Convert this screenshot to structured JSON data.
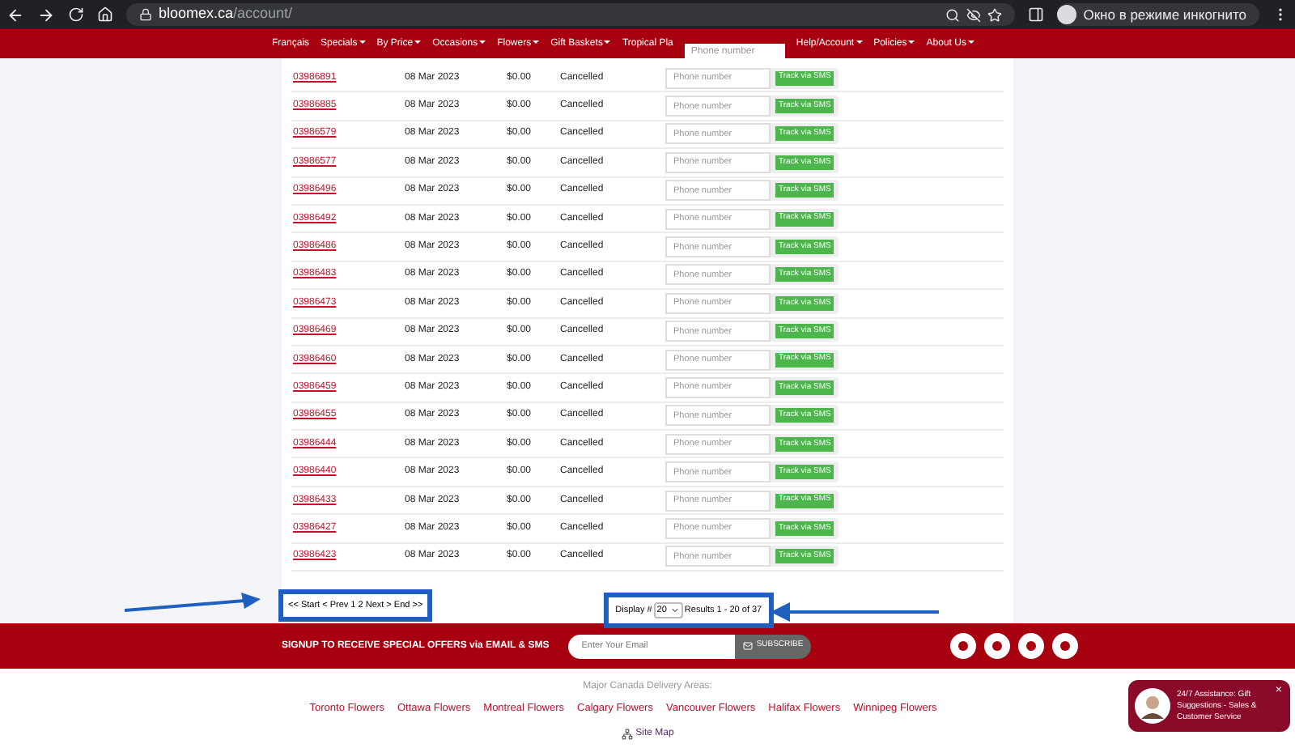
{
  "browser": {
    "url_host": "bloomex.ca",
    "url_path": "/account/",
    "profile": "Окно в режиме инкогнито"
  },
  "nav": [
    {
      "label": "Français",
      "dropdown": false
    },
    {
      "label": "Specials",
      "dropdown": true
    },
    {
      "label": "By Price",
      "dropdown": true
    },
    {
      "label": "Occasions",
      "dropdown": true
    },
    {
      "label": "Flowers",
      "dropdown": true
    },
    {
      "label": "Gift Baskets",
      "dropdown": true
    },
    {
      "label": "Tropical Pla",
      "dropdown": false
    },
    {
      "label": "Help/Account",
      "dropdown": true
    },
    {
      "label": "Policies",
      "dropdown": true
    },
    {
      "label": "About Us",
      "dropdown": true
    }
  ],
  "overlay_field": {
    "placeholder": "Phone number"
  },
  "orders": [
    {
      "number": "03986891",
      "date": "08 Mar 2023",
      "total": "$0.00",
      "status": "Cancelled",
      "placeholder": "Phone number",
      "button": "Track via SMS"
    },
    {
      "number": "03986885",
      "date": "08 Mar 2023",
      "total": "$0.00",
      "status": "Cancelled",
      "placeholder": "Phone number",
      "button": "Track via SMS"
    },
    {
      "number": "03986579",
      "date": "08 Mar 2023",
      "total": "$0.00",
      "status": "Cancelled",
      "placeholder": "Phone number",
      "button": "Track via SMS"
    },
    {
      "number": "03986577",
      "date": "08 Mar 2023",
      "total": "$0.00",
      "status": "Cancelled",
      "placeholder": "Phone number",
      "button": "Track via SMS"
    },
    {
      "number": "03986496",
      "date": "08 Mar 2023",
      "total": "$0.00",
      "status": "Cancelled",
      "placeholder": "Phone number",
      "button": "Track via SMS"
    },
    {
      "number": "03986492",
      "date": "08 Mar 2023",
      "total": "$0.00",
      "status": "Cancelled",
      "placeholder": "Phone number",
      "button": "Track via SMS"
    },
    {
      "number": "03986486",
      "date": "08 Mar 2023",
      "total": "$0.00",
      "status": "Cancelled",
      "placeholder": "Phone number",
      "button": "Track via SMS"
    },
    {
      "number": "03986483",
      "date": "08 Mar 2023",
      "total": "$0.00",
      "status": "Cancelled",
      "placeholder": "Phone number",
      "button": "Track via SMS"
    },
    {
      "number": "03986473",
      "date": "08 Mar 2023",
      "total": "$0.00",
      "status": "Cancelled",
      "placeholder": "Phone number",
      "button": "Track via SMS"
    },
    {
      "number": "03986469",
      "date": "08 Mar 2023",
      "total": "$0.00",
      "status": "Cancelled",
      "placeholder": "Phone number",
      "button": "Track via SMS"
    },
    {
      "number": "03986460",
      "date": "08 Mar 2023",
      "total": "$0.00",
      "status": "Cancelled",
      "placeholder": "Phone number",
      "button": "Track via SMS"
    },
    {
      "number": "03986459",
      "date": "08 Mar 2023",
      "total": "$0.00",
      "status": "Cancelled",
      "placeholder": "Phone number",
      "button": "Track via SMS"
    },
    {
      "number": "03986455",
      "date": "08 Mar 2023",
      "total": "$0.00",
      "status": "Cancelled",
      "placeholder": "Phone number",
      "button": "Track via SMS"
    },
    {
      "number": "03986444",
      "date": "08 Mar 2023",
      "total": "$0.00",
      "status": "Cancelled",
      "placeholder": "Phone number",
      "button": "Track via SMS"
    },
    {
      "number": "03986440",
      "date": "08 Mar 2023",
      "total": "$0.00",
      "status": "Cancelled",
      "placeholder": "Phone number",
      "button": "Track via SMS"
    },
    {
      "number": "03986433",
      "date": "08 Mar 2023",
      "total": "$0.00",
      "status": "Cancelled",
      "placeholder": "Phone number",
      "button": "Track via SMS"
    },
    {
      "number": "03986427",
      "date": "08 Mar 2023",
      "total": "$0.00",
      "status": "Cancelled",
      "placeholder": "Phone number",
      "button": "Track via SMS"
    },
    {
      "number": "03986423",
      "date": "08 Mar 2023",
      "total": "$0.00",
      "status": "Cancelled",
      "placeholder": "Phone number",
      "button": "Track via SMS"
    }
  ],
  "pagination": "<< Start < Prev 1 2 Next > End >>",
  "display": {
    "label": "Display #",
    "value": "20",
    "results": "Results 1 - 20 of 37"
  },
  "signup": {
    "text": "SIGNUP TO RECEIVE SPECIAL OFFERS via EMAIL & SMS",
    "placeholder": "Enter Your Email",
    "button": "SUBSCRIBE"
  },
  "delivery": {
    "heading": "Major Canada Delivery Areas:",
    "cities": [
      "Toronto Flowers",
      "Ottawa Flowers",
      "Montreal Flowers",
      "Calgary Flowers",
      "Vancouver Flowers",
      "Halifax Flowers",
      "Winnipeg Flowers"
    ],
    "sitemap": "Site Map"
  },
  "chat": {
    "text": "24/7 Assistance: Gift Suggestions - Sales & Customer Service",
    "close": "×"
  }
}
